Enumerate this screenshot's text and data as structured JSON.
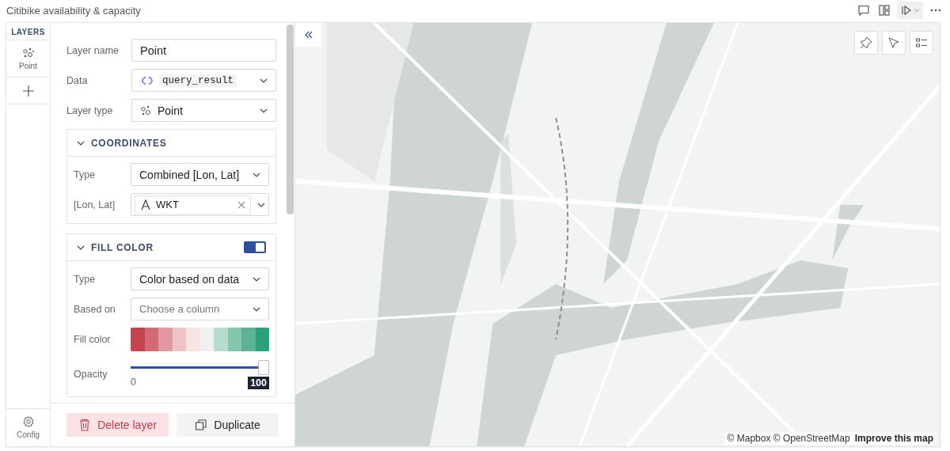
{
  "title": "Citibike availability & capacity",
  "rail": {
    "header": "LAYERS",
    "layers": [
      {
        "label": "Point",
        "selected": true
      }
    ],
    "config": "Config"
  },
  "form": {
    "layer_name": {
      "label": "Layer name",
      "value": "Point"
    },
    "data": {
      "label": "Data",
      "value": "query_result"
    },
    "layer_type": {
      "label": "Layer type",
      "value": "Point"
    }
  },
  "sections": [
    {
      "title": "COORDINATES",
      "expanded": true,
      "fields": [
        {
          "kind": "select",
          "label": "Type",
          "value": "Combined [Lon, Lat]"
        },
        {
          "kind": "column",
          "label": "[Lon, Lat]",
          "value": "WKT"
        }
      ]
    },
    {
      "title": "FILL COLOR",
      "expanded": true,
      "toggle": {
        "on": true
      },
      "fields": [
        {
          "kind": "select",
          "label": "Type",
          "value": "Color based on data"
        },
        {
          "kind": "placeholder",
          "label": "Based on",
          "placeholder": "Choose a column"
        },
        {
          "kind": "palette",
          "label": "Fill color",
          "colors": [
            {
              "color": "#c4434f"
            },
            {
              "color": "#d46a73"
            },
            {
              "color": "#e09a9f"
            },
            {
              "color": "#ecc3c6"
            },
            {
              "color": "#f6e3e4"
            },
            {
              "color": "#eff1f0"
            },
            {
              "color": "#b5dccf"
            },
            {
              "color": "#86c6ad"
            },
            {
              "color": "#5bb393"
            },
            {
              "color": "#2aa178"
            }
          ]
        },
        {
          "kind": "slider",
          "label": "Opacity",
          "level": 1,
          "min": "0",
          "reading": "100"
        }
      ]
    }
  ],
  "footer": {
    "delete": "Delete layer",
    "duplicate": "Duplicate"
  },
  "map": {
    "kind": "picture",
    "attribution": "© Mapbox © OpenStreetMap",
    "improve": "Improve this map"
  }
}
